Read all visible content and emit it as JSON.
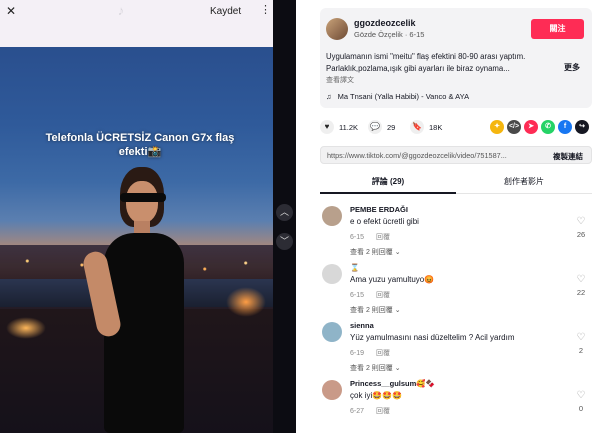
{
  "video_header": {
    "close_glyph": "✕",
    "save_label": "Kaydet",
    "more_glyph": "⋮"
  },
  "video": {
    "caption": "Telefonla ÜCRETSİZ Canon G7x flaş efekti📸"
  },
  "author": {
    "username": "ggozdeozcelik",
    "subtitle": "Gözde Özçelik · 6-15",
    "follow_label": "關注",
    "description": "Uygulamanın ismi \"meitu\" flaş efektini 80-90 arası yaptım. Parlaklık,pozlama,ışık gibi ayarları ile biraz oynama...",
    "more_label": "更多",
    "translate_label": "查看譯文",
    "music": "Ma Tnsani (Yalla Habibi) - Vanco & AYA"
  },
  "actions": {
    "likes": "11.2K",
    "comments": "29",
    "saves": "18K"
  },
  "link": {
    "url": "https://www.tiktok.com/@ggozdeozcelik/video/751587...",
    "copy_label": "複製連結"
  },
  "tabs": {
    "comments_label": "評論 (29)",
    "creator_label": "創作者影片"
  },
  "comments": [
    {
      "name": "PEMBE ERDAĞI",
      "text": "e o efekt ücretli gibi",
      "date": "6-15",
      "reply": "回覆",
      "replies": "查看 2 則回覆 ⌄",
      "likes": "26",
      "avatar_color": "#b8a08c"
    },
    {
      "name": "⌛",
      "text": "Ama yuzu yamultuyo😡",
      "date": "6-15",
      "reply": "回覆",
      "replies": "查看 2 則回覆 ⌄",
      "likes": "22",
      "avatar_color": "#d8d8d8"
    },
    {
      "name": "sienna",
      "text": "Yüz yamulmasını nasi düzeltelim ? Acil yardım",
      "date": "6-19",
      "reply": "回覆",
      "replies": "查看 2 則回覆 ⌄",
      "likes": "2",
      "avatar_color": "#8fb4c8"
    },
    {
      "name": "Princess__gulsum🥰🍫",
      "text": "çok iyi🤩🤩🤩",
      "date": "6-27",
      "reply": "回覆",
      "replies": "",
      "likes": "0",
      "avatar_color": "#c99a88"
    }
  ],
  "share_icons": [
    {
      "name": "coin-share-icon",
      "color": "#f5b60f",
      "glyph": "✦"
    },
    {
      "name": "embed-icon",
      "color": "#4a4a4a",
      "glyph": "</>"
    },
    {
      "name": "send-icon",
      "color": "#fe2c55",
      "glyph": "➤"
    },
    {
      "name": "whatsapp-icon",
      "color": "#25d366",
      "glyph": "✆"
    },
    {
      "name": "facebook-icon",
      "color": "#1877f2",
      "glyph": "f"
    },
    {
      "name": "share-arrow-icon",
      "color": "#161823",
      "glyph": "↪"
    }
  ]
}
